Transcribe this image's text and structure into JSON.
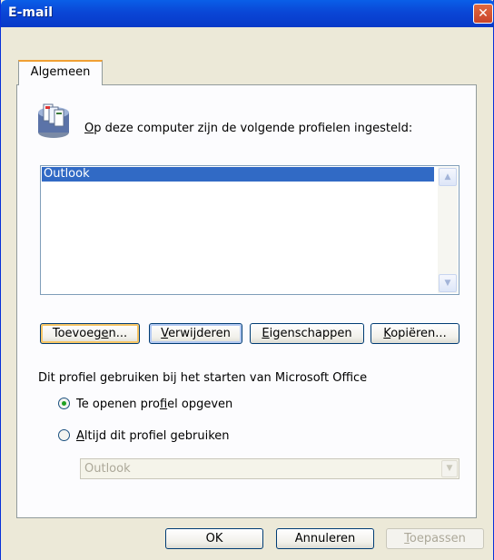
{
  "window": {
    "title": "E-mail",
    "close_label": "✕"
  },
  "tab": {
    "label": "Algemeen"
  },
  "intro": {
    "accesskey": "O",
    "rest": "p deze computer zijn de volgende profielen ingesteld:"
  },
  "profiles": {
    "items": [
      "Outlook"
    ],
    "selected": "Outlook"
  },
  "buttons": {
    "add": {
      "pre": "Toevoeg",
      "key": "e",
      "post": "n..."
    },
    "remove": {
      "pre": "",
      "key": "V",
      "post": "erwijderen"
    },
    "properties": {
      "pre": "",
      "key": "E",
      "post": "igenschappen"
    },
    "copy": {
      "pre": "",
      "key": "K",
      "post": "opiëren..."
    }
  },
  "startup": {
    "label": "Dit profiel gebruiken bij het starten van Microsoft Office",
    "option_prompt": {
      "pre": "Te openen pro",
      "key": "f",
      "post": "iel opgeven",
      "checked": true
    },
    "option_always": {
      "pre": "",
      "key": "A",
      "post": "ltijd dit profiel gebruiken",
      "checked": false
    },
    "combo_value": "Outlook"
  },
  "dialog_buttons": {
    "ok": "OK",
    "cancel": "Annuleren",
    "apply": {
      "key": "T",
      "post": "oepassen"
    }
  },
  "icons": {
    "profiles": "mail-profiles-icon",
    "close": "close-icon",
    "scroll_up": "chevron-up-icon",
    "scroll_down": "chevron-down-icon",
    "combo": "chevron-down-icon"
  },
  "colors": {
    "selection": "#316ac5",
    "titlebar": "#0a46d6",
    "dialog_bg": "#ece9d8"
  }
}
